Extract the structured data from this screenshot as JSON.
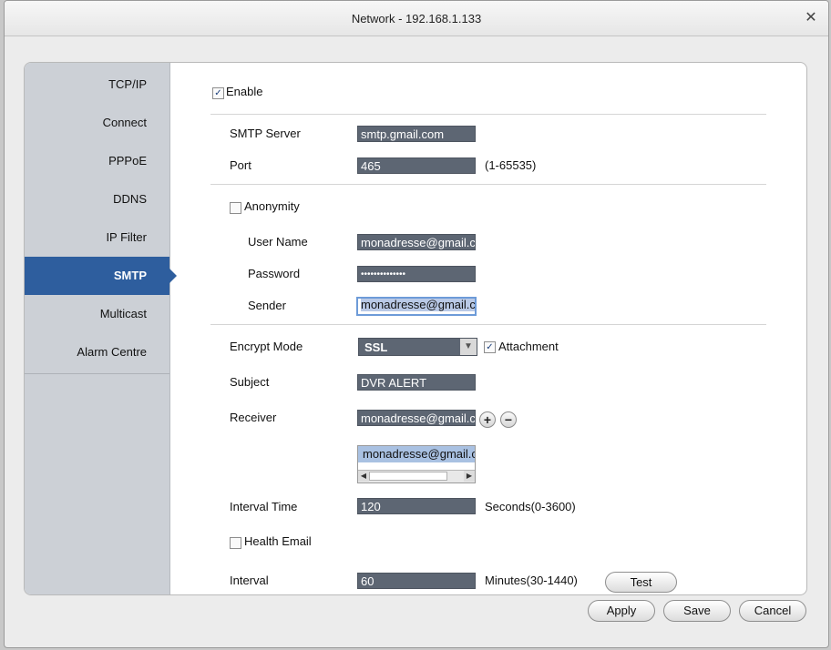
{
  "window": {
    "title": "Network - 192.168.1.133"
  },
  "icons": {
    "close": "close-icon",
    "checked": "✓"
  },
  "sidebar": {
    "items": [
      {
        "label": "TCP/IP"
      },
      {
        "label": "Connect"
      },
      {
        "label": "PPPoE"
      },
      {
        "label": "DDNS"
      },
      {
        "label": "IP Filter"
      },
      {
        "label": "SMTP",
        "active": true
      },
      {
        "label": "Multicast"
      },
      {
        "label": "Alarm Centre"
      }
    ]
  },
  "form": {
    "enable_label": "Enable",
    "smtp_server_label": "SMTP Server",
    "smtp_server_value": "smtp.gmail.com",
    "port_label": "Port",
    "port_value": "465",
    "port_range": "(1-65535)",
    "anonymity_label": "Anonymity",
    "username_label": "User Name",
    "username_value": "monadresse@gmail.c",
    "password_label": "Password",
    "password_value": "••••••••••••••",
    "sender_label": "Sender",
    "sender_value": "monadresse@gmail.c",
    "encrypt_label": "Encrypt Mode",
    "encrypt_value": "SSL",
    "attachment_label": "Attachment",
    "subject_label": "Subject",
    "subject_value": "DVR ALERT",
    "receiver_label": "Receiver",
    "receiver_value": "monadresse@gmail.c",
    "receiver_list": [
      "monadresse@gmail.c"
    ],
    "interval_time_label": "Interval Time",
    "interval_time_value": "120",
    "interval_time_unit": "Seconds(0-3600)",
    "health_email_label": "Health Email",
    "interval_label": "Interval",
    "interval_value": "60",
    "interval_unit": "Minutes(30-1440)",
    "test_label": "Test"
  },
  "buttons": {
    "apply": "Apply",
    "save": "Save",
    "cancel": "Cancel"
  },
  "colors": {
    "active_nav": "#2e5e9e",
    "field_bg": "#5d6673",
    "sidebar_bg": "#ccd0d6"
  }
}
